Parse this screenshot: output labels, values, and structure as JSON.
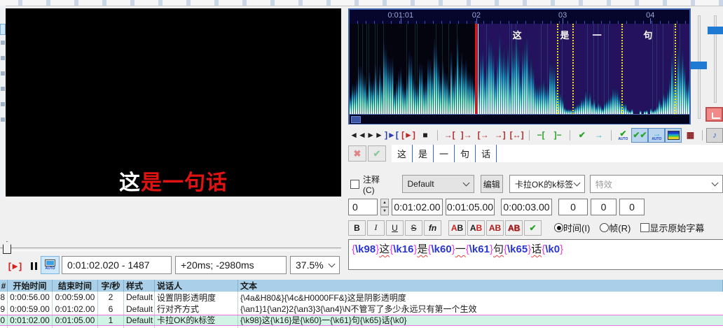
{
  "video": {
    "subtitle": {
      "sung": "这",
      "unsung": "是一句话"
    },
    "controls": {
      "play_label": "[►]",
      "auto_label": "AUTO",
      "position": "0:01:02.020 - 1487",
      "relative_times": "+20ms; -2980ms",
      "zoom": "37.5%"
    }
  },
  "audio": {
    "timeline_labels": [
      "0:01:01",
      "02",
      "03",
      "04"
    ],
    "region_labels": [
      "这",
      "是",
      "一",
      "句"
    ],
    "syllables": [
      "这",
      "是",
      "一",
      "句",
      "话"
    ],
    "accent_colors": {
      "selection": "#2c1670",
      "marker_red": "#e51212",
      "karaoke_divider": "#f0e000",
      "frame_blue": "#3f62b0"
    },
    "toolbar": [
      {
        "name": "play-before-button",
        "glyph": "◄◄",
        "color": "#202020"
      },
      {
        "name": "play-after-button",
        "glyph": "►►",
        "color": "#202020"
      },
      {
        "name": "play-selection-button",
        "glyph": "]►[",
        "color": "#2a3bb8"
      },
      {
        "name": "play-line-button",
        "glyph": "[►]",
        "color": "#c22525",
        "sep_after": false
      },
      {
        "name": "stop-button",
        "glyph": "■",
        "color": "#202020",
        "sep_after": true
      },
      {
        "name": "shift-start-left-button",
        "glyph": "→[",
        "color": "#b03030"
      },
      {
        "name": "shift-start-right-button",
        "glyph": "]→",
        "color": "#b03030"
      },
      {
        "name": "shift-end-left-button",
        "glyph": "[→",
        "color": "#b03030"
      },
      {
        "name": "shift-end-right-button",
        "glyph": "→]",
        "color": "#b03030"
      },
      {
        "name": "snap-markers-button",
        "glyph": "[↔]",
        "color": "#b03030",
        "sep_after": true
      },
      {
        "name": "lead-in-button",
        "glyph": "−[",
        "color": "#2e9e2e"
      },
      {
        "name": "lead-out-button",
        "glyph": "]−",
        "color": "#2e9e2e",
        "sep_after": true
      },
      {
        "name": "commit-button",
        "glyph": "✔",
        "color": "#27a527"
      },
      {
        "name": "go-to-selection-button",
        "glyph": "→",
        "color": "#1fb3cc",
        "sep_after": true
      },
      {
        "name": "auto-commit-button",
        "glyph": "✔",
        "color": "#27a527",
        "sub": "AUTO"
      },
      {
        "name": "auto-next-line-button",
        "glyph": "✔✔",
        "color": "#27a527",
        "toggled": true
      },
      {
        "name": "auto-scroll-button",
        "glyph": "→",
        "color": "#1fb3cc",
        "sub": "AUTO",
        "toggled": true
      },
      {
        "name": "spectrum-display-button",
        "glyph": "",
        "color": "#1a3acc",
        "toggled": true,
        "icon": "spectrum"
      },
      {
        "name": "vertical-zoom-link-button",
        "glyph": "▦",
        "color": "#8a2020",
        "sep_after": true
      },
      {
        "name": "karaoke-mode-button",
        "glyph": "♪",
        "color": "#3a6ecc",
        "pressed": true
      }
    ],
    "karaoke_bar": {
      "cancel_glyph": "✖",
      "accept_glyph": "✔"
    }
  },
  "edit": {
    "comment_label": "注释(C)",
    "style": "Default",
    "edit_button": "编辑",
    "actor": "卡拉OK的k标签",
    "effect_placeholder": "特效",
    "layer": "0",
    "start_time": "0:01:02.00",
    "end_time": "0:01:05.00",
    "duration": "0:00:03.00",
    "margins": [
      "0",
      "0",
      "0"
    ],
    "format_buttons": {
      "bold": "B",
      "italic": "I",
      "underline": "U",
      "strike": "S",
      "fn": "fn"
    },
    "color_buttons": [
      "AB",
      "AB",
      "AB",
      "AB"
    ],
    "commit_glyph": "✔",
    "time_radio": "时间(I)",
    "frame_radio": "帧(R)",
    "show_original": "显示原始字幕",
    "text": "{\\k98}这{\\k16}是{\\k60}一{\\k61}句{\\k65}话{\\k0}"
  },
  "grid": {
    "headers": [
      "#",
      "开始时间",
      "结束时间",
      "字/秒",
      "样式",
      "说话人",
      "文本"
    ],
    "rows": [
      {
        "num": "8",
        "start": "0:00:56.00",
        "end": "0:00:59.00",
        "cps": "2",
        "style": "Default",
        "actor": "设置阴影透明度",
        "text": "{\\4a&H80&}{\\4c&H0000FF&}这是阴影透明度",
        "selected": false
      },
      {
        "num": "9",
        "start": "0:00:59.00",
        "end": "0:01:02.00",
        "cps": "6",
        "style": "Default",
        "actor": "行对齐方式",
        "text": "{\\an1}1{\\an2}2{\\an3}3{\\an4}\\N不管写了多少永远只有第一个生效",
        "selected": false
      },
      {
        "num": "0",
        "start": "0:01:02.00",
        "end": "0:01:05.00",
        "cps": "1",
        "style": "Default",
        "actor": "卡拉OK的k标签",
        "text": "{\\k98}这{\\k16}是{\\k60}一{\\k61}句{\\k65}话{\\k0}",
        "selected": true
      }
    ]
  }
}
